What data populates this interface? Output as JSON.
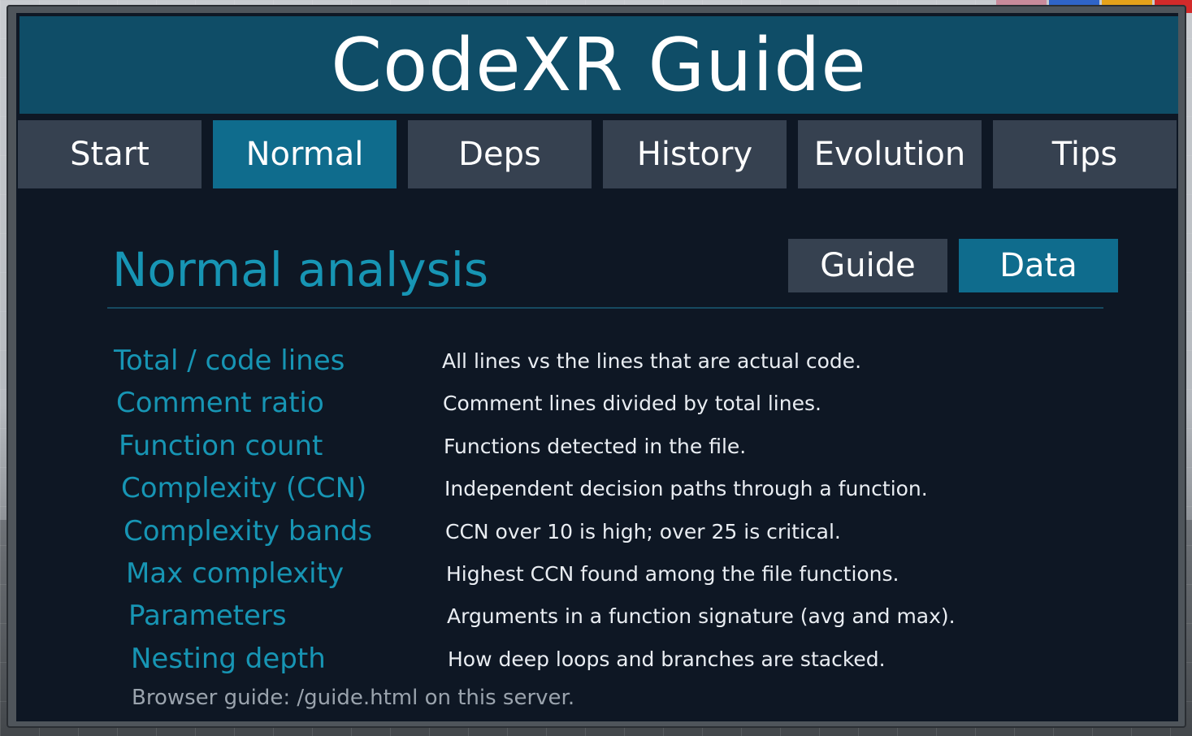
{
  "environment": {
    "accent_colors": [
      "#c98b9b",
      "#2f64c8",
      "#e5a21a",
      "#d32a2a"
    ]
  },
  "board": {
    "title": "CodeXR Guide",
    "tabs": [
      {
        "label": "Start",
        "active": false
      },
      {
        "label": "Normal",
        "active": true
      },
      {
        "label": "Deps",
        "active": false
      },
      {
        "label": "History",
        "active": false
      },
      {
        "label": "Evolution",
        "active": false
      },
      {
        "label": "Tips",
        "active": false
      }
    ],
    "section_title": "Normal analysis",
    "toggles": [
      {
        "label": "Guide",
        "active": false
      },
      {
        "label": "Data",
        "active": true
      }
    ],
    "rows": [
      {
        "term": "Total / code lines",
        "description": "All lines vs the lines that are actual code."
      },
      {
        "term": "Comment ratio",
        "description": "Comment lines divided by total lines."
      },
      {
        "term": "Function count",
        "description": "Functions detected in the file."
      },
      {
        "term": "Complexity (CCN)",
        "description": "Independent decision paths through a function."
      },
      {
        "term": "Complexity bands",
        "description": "CCN over 10 is high; over 25 is critical."
      },
      {
        "term": "Max complexity",
        "description": "Highest CCN found among the file functions."
      },
      {
        "term": "Parameters",
        "description": "Arguments in a function signature (avg and max)."
      },
      {
        "term": "Nesting depth",
        "description": "How deep loops and branches are stacked."
      }
    ],
    "footer_note": "Browser guide: /guide.html on this server.",
    "colors": {
      "title_bar": "#0f4d67",
      "active_tab": "#0f6c8d",
      "inactive_tab": "#364150",
      "panel_bg": "#0e1724",
      "term_text": "#1795b4",
      "desc_text": "#e9edf2"
    }
  }
}
